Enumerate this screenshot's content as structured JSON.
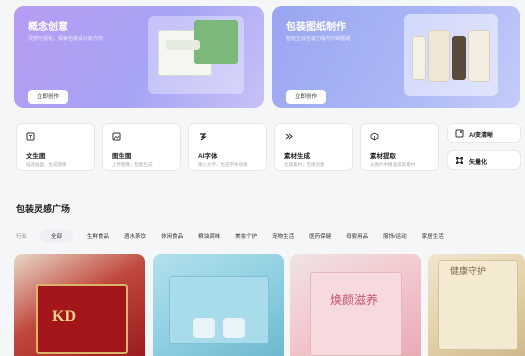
{
  "banners": [
    {
      "title": "概念创意",
      "subtitle": "灵感可视化，探索包装设计新方向",
      "button": "立即创作"
    },
    {
      "title": "包装图纸制作",
      "subtitle": "智能生成包装刀版与印刷图纸",
      "button": "立即创作"
    }
  ],
  "tools": [
    {
      "icon": "image-text-icon",
      "title": "文生图",
      "desc": "描述画面，生成图像"
    },
    {
      "icon": "image-image-icon",
      "title": "图生图",
      "desc": "上传图像，智能生成"
    },
    {
      "icon": "font-icon",
      "title": "AI字体",
      "desc": "输入文字，生成字体效果"
    },
    {
      "icon": "material-icon",
      "title": "素材生成",
      "desc": "生成素材，无限创意"
    },
    {
      "icon": "extract-icon",
      "title": "素材提取",
      "desc": "从图片中精准提取素材"
    }
  ],
  "mini_tools": [
    {
      "icon": "ai-sharpen-icon",
      "label": "AI变清晰"
    },
    {
      "icon": "vectorize-icon",
      "label": "矢量化"
    }
  ],
  "section_title": "包装灵感广场",
  "filter": {
    "label": "行业",
    "chips": [
      "全部",
      "生鲜食品",
      "酒水茶饮",
      "休闲食品",
      "粮油调味",
      "美妆个护",
      "宠物生活",
      "医药保健",
      "母婴用品",
      "服饰/运动",
      "家居生活"
    ],
    "active": "全部"
  },
  "products": [
    {
      "mark": "KD"
    },
    {
      "mark": ""
    },
    {
      "mark": "焕颜滋养"
    },
    {
      "mark": "健康守护"
    }
  ],
  "colors": {
    "banner_left": "#b79cf3",
    "banner_right": "#9aa5f2",
    "accent": "#222222"
  }
}
